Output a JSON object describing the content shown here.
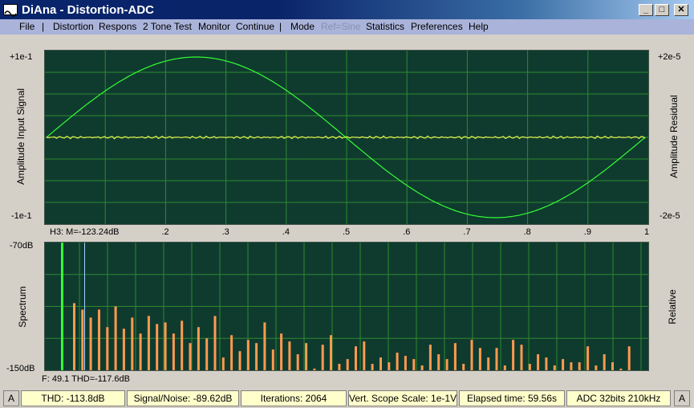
{
  "window": {
    "title": "DiAna - Distortion-ADC",
    "min_glyph": "_",
    "max_glyph": "□",
    "close_glyph": "✕"
  },
  "menu": {
    "file": "File",
    "sep1": "|",
    "distortion": "Distortion",
    "respons": "Respons",
    "two_tone": "2 Tone Test",
    "monitor": "Monitor",
    "continue": "Continue",
    "sep2": "|",
    "mode": "Mode",
    "ref_sine": "Ref=Sine",
    "statistics": "Statistics",
    "preferences": "Preferences",
    "help": "Help"
  },
  "top_plot": {
    "y_top_left": "+1e-1",
    "y_bottom_left": "-1e-1",
    "y_top_right": "+2e-5",
    "y_bottom_right": "-2e-5",
    "left_label": "Amplitude Input Signal",
    "right_label": "Amplitude Residual",
    "marker": "H3: M=-123.24dB",
    "x_ticks": [
      ".2",
      ".3",
      ".4",
      ".5",
      ".6",
      ".7",
      ".8",
      ".9",
      "1"
    ],
    "signal_color": "#33ff33",
    "residual_color": "#e8f050"
  },
  "bottom_plot": {
    "y_top": "-70dB",
    "y_bottom": "-150dB",
    "left_label": "Spectrum",
    "right_label": "Relative",
    "footer": "F: 49.1 THD=-117.6dB",
    "fundamental_color": "#33ff33",
    "harmonic_color": "#ff9a50",
    "marker_color": "#a0d0ff"
  },
  "chart_data": {
    "type": "bar",
    "ylim": [
      -150,
      -70
    ],
    "fundamental": -70,
    "harmonic_levels": [
      -108,
      -112,
      -117,
      -112,
      -123,
      -110,
      -124,
      -117,
      -127,
      -116,
      -121,
      -120,
      -127,
      -119,
      -133,
      -123,
      -130,
      -116,
      -142,
      -128,
      -138,
      -131,
      -133,
      -120,
      -137,
      -127,
      -132,
      -140,
      -133,
      -149,
      -134,
      -128,
      -146,
      -143,
      -135,
      -132,
      -146,
      -142,
      -145,
      -139,
      -141,
      -143,
      -147,
      -134,
      -140,
      -143,
      -133,
      -146,
      -131,
      -136,
      -142,
      -136,
      -147,
      -131,
      -134,
      -146,
      -140,
      -142,
      -147,
      -143,
      -145,
      -145,
      -135,
      -147,
      -140,
      -145,
      -149,
      -135
    ]
  },
  "status": {
    "left_a": "A",
    "thd": "THD: -113.8dB",
    "snr": "Signal/Noise: -89.62dB",
    "iterations": "Iterations: 2064",
    "vscale": "Vert. Scope Scale: 1e-1V",
    "elapsed": "Elapsed time: 59.56s",
    "adc": "ADC 32bits 210kHz",
    "right_a": "A"
  }
}
